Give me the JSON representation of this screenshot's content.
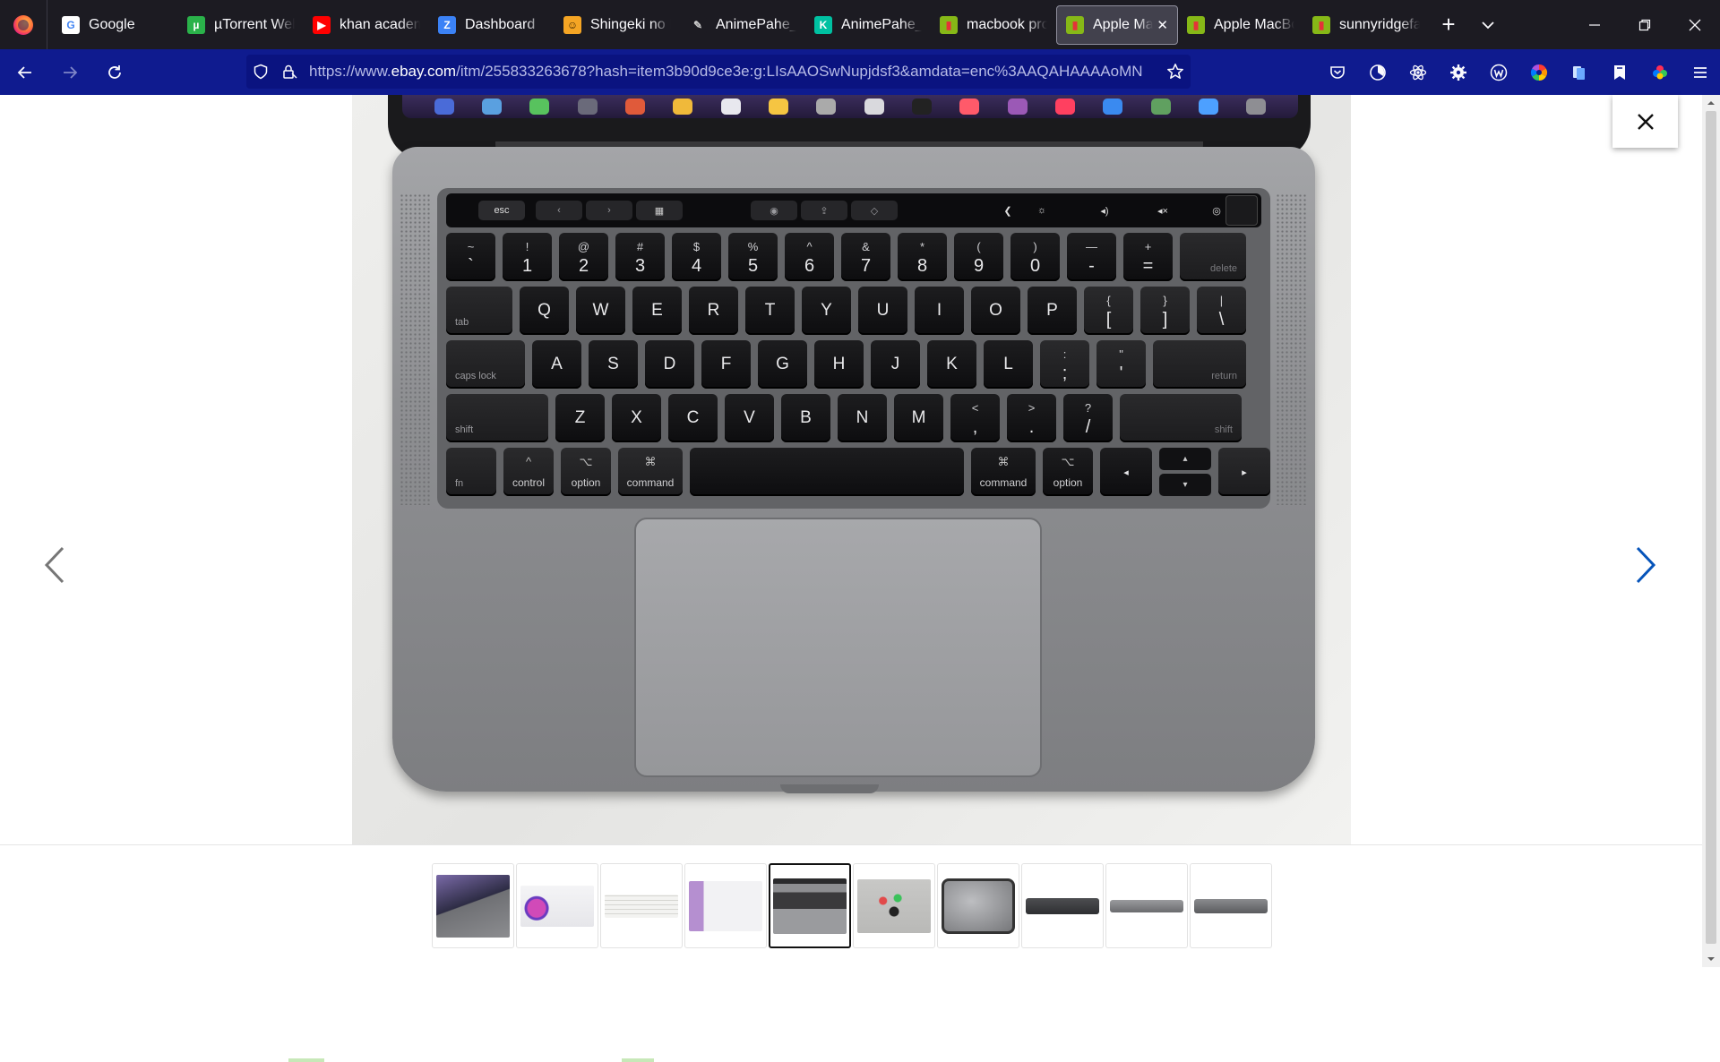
{
  "browser": {
    "tabs": [
      {
        "title": "Google",
        "fav_color": "#ffffff",
        "fav_text": "G",
        "fav_fg": "#4285f4"
      },
      {
        "title": "µTorrent Web",
        "fav_color": "#2ab24a",
        "fav_text": "µ",
        "fav_fg": "#ffffff"
      },
      {
        "title": "khan academy",
        "fav_color": "#ff0000",
        "fav_text": "▶",
        "fav_fg": "#ffffff"
      },
      {
        "title": "Dashboard",
        "fav_color": "#3b82f6",
        "fav_text": "Z",
        "fav_fg": "#ffffff"
      },
      {
        "title": "Shingeki no Kyojin",
        "fav_color": "#f5a524",
        "fav_text": "☺",
        "fav_fg": "#3b2400"
      },
      {
        "title": "AnimePahe_S",
        "fav_color": "#1c1b22",
        "fav_text": "✎",
        "fav_fg": "#cccccc"
      },
      {
        "title": "AnimePahe_S",
        "fav_color": "#00c1a2",
        "fav_text": "K",
        "fav_fg": "#ffffff"
      },
      {
        "title": "macbook pro",
        "fav_color": "#86b817",
        "fav_text": "▮",
        "fav_fg": "#e53238"
      },
      {
        "title": "Apple Mac",
        "fav_color": "#86b817",
        "fav_text": "▮",
        "fav_fg": "#e53238",
        "active": true
      },
      {
        "title": "Apple MacBook",
        "fav_color": "#86b817",
        "fav_text": "▮",
        "fav_fg": "#e53238"
      },
      {
        "title": "sunnyridgefarm",
        "fav_color": "#86b817",
        "fav_text": "▮",
        "fav_fg": "#e53238"
      }
    ],
    "new_tab": "+",
    "url_prefix": "https://www.",
    "url_domain": "ebay.com",
    "url_rest": "/itm/255833263678?hash=item3b90d9ce3e:g:LIsAAOSwNupjdsf3&amdata=enc%3AAQAHAAAAoMN",
    "nav_color": "#0f1b8f"
  },
  "keyboard": {
    "touchbar": {
      "esc": "esc"
    },
    "row_numbers": [
      {
        "top": "~",
        "bot": "`"
      },
      {
        "top": "!",
        "bot": "1"
      },
      {
        "top": "@",
        "bot": "2"
      },
      {
        "top": "#",
        "bot": "3"
      },
      {
        "top": "$",
        "bot": "4"
      },
      {
        "top": "%",
        "bot": "5"
      },
      {
        "top": "^",
        "bot": "6"
      },
      {
        "top": "&",
        "bot": "7"
      },
      {
        "top": "*",
        "bot": "8"
      },
      {
        "top": "(",
        "bot": "9"
      },
      {
        "top": ")",
        "bot": "0"
      },
      {
        "top": "—",
        "bot": "-"
      },
      {
        "top": "+",
        "bot": "="
      }
    ],
    "delete": "delete",
    "tab": "tab",
    "row_q": [
      "Q",
      "W",
      "E",
      "R",
      "T",
      "Y",
      "U",
      "I",
      "O",
      "P"
    ],
    "brackets": [
      {
        "top": "{",
        "bot": "["
      },
      {
        "top": "}",
        "bot": "]"
      },
      {
        "top": "|",
        "bot": "\\"
      }
    ],
    "caps": "caps lock",
    "row_a": [
      "A",
      "S",
      "D",
      "F",
      "G",
      "H",
      "J",
      "K",
      "L"
    ],
    "semis": [
      {
        "top": ":",
        "bot": ";"
      },
      {
        "top": "\"",
        "bot": "'"
      }
    ],
    "return": "return",
    "shift": "shift",
    "row_z": [
      "Z",
      "X",
      "C",
      "V",
      "B",
      "N",
      "M"
    ],
    "punct": [
      {
        "top": "<",
        "bot": ","
      },
      {
        "top": ">",
        "bot": "."
      },
      {
        "top": "?",
        "bot": "/"
      }
    ],
    "fn": "fn",
    "control": "control",
    "option": "option",
    "command": "command",
    "cmd_sym": "⌘",
    "opt_sym": "⌥",
    "ctrl_sym": "^"
  },
  "gallery": {
    "thumbnail_count": 10,
    "active_index": 4
  }
}
